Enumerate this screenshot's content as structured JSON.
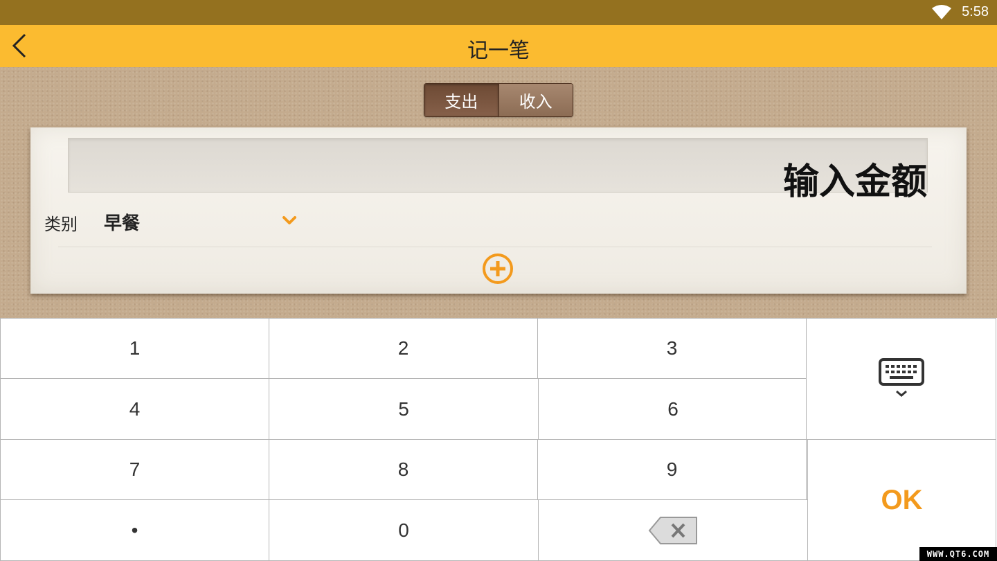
{
  "status_bar": {
    "time": "5:58",
    "wifi_icon": "wifi-icon"
  },
  "app_bar": {
    "title": "记一笔",
    "back_icon": "chevron-left-icon"
  },
  "tabs": [
    {
      "label": "支出",
      "active": true
    },
    {
      "label": "收入",
      "active": false
    }
  ],
  "form": {
    "amount_placeholder": "输入金额",
    "category_label": "类别",
    "category_value": "早餐",
    "category_chevron_icon": "chevron-down-icon",
    "add_icon": "plus-circle-icon"
  },
  "keypad": {
    "keys": [
      "1",
      "2",
      "3",
      "4",
      "5",
      "6",
      "7",
      "8",
      "9",
      "•",
      "0"
    ],
    "hide_keyboard_icon": "keyboard-hide-icon",
    "backspace_icon": "backspace-icon",
    "ok_label": "OK"
  },
  "watermark": "WWW.QT6.COM",
  "colors": {
    "status_bar": "#94711f",
    "app_bar": "#fbbb30",
    "accent": "#f39a1d",
    "tab_active": "#6d4a34"
  }
}
